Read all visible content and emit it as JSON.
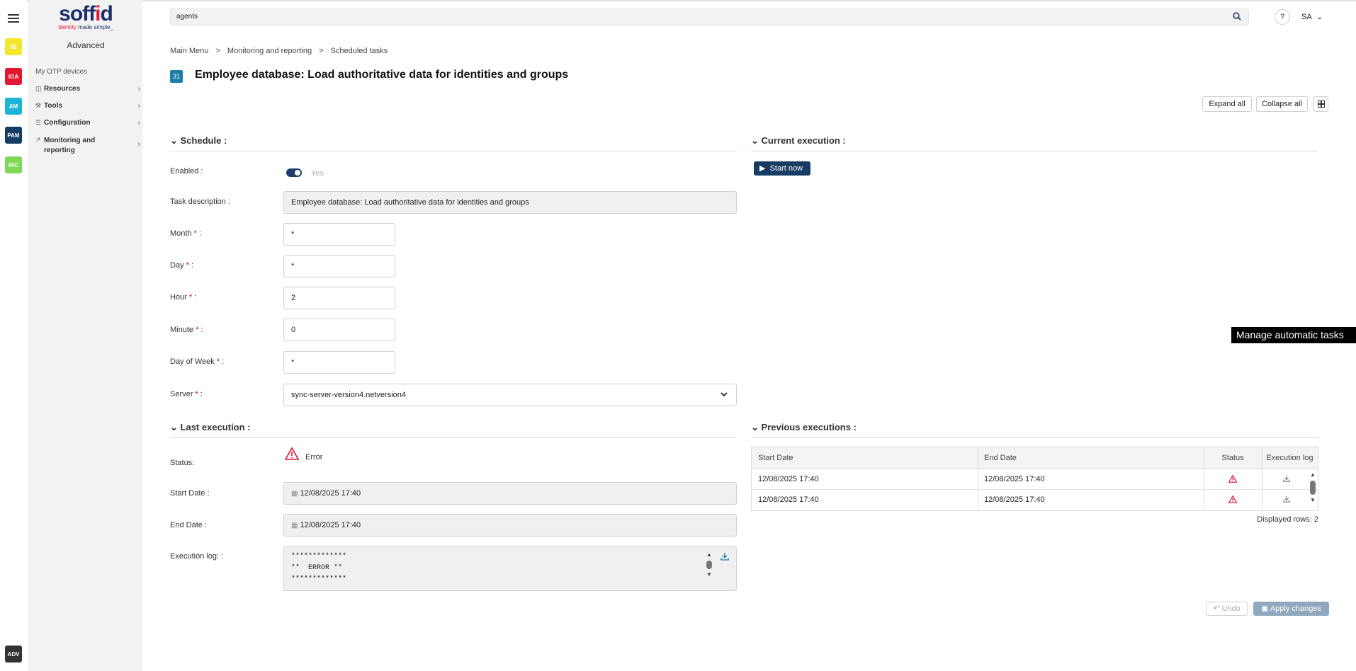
{
  "rail": {
    "apps": [
      {
        "label": "IIS",
        "color": "#f5e52c"
      },
      {
        "label": "IGA",
        "color": "#e3172f"
      },
      {
        "label": "AM",
        "color": "#1cb4d4"
      },
      {
        "label": "PAM",
        "color": "#173c64"
      },
      {
        "label": "IRC",
        "color": "#7ed957"
      }
    ],
    "bottom_app": {
      "label": "ADV",
      "color": "#333333"
    }
  },
  "sidebar": {
    "logo_text_a": "soff",
    "logo_text_i": "i",
    "logo_text_b": "d",
    "logo_tagline_a": "Identity",
    "logo_tagline_b": " made simple_",
    "mode_label": "Advanced",
    "items": [
      {
        "label": "My OTP devices"
      },
      {
        "label": "Resources"
      },
      {
        "label": "Tools"
      },
      {
        "label": "Configuration"
      },
      {
        "label": "Monitoring and reporting"
      }
    ]
  },
  "header": {
    "search_value": "agents",
    "help": "?",
    "user": "SA"
  },
  "breadcrumb": [
    "Main Menu",
    "Monitoring and reporting",
    "Scheduled tasks"
  ],
  "breadcrumb_sep": ">",
  "title": "Employee database: Load authoritative data for identities and groups",
  "toolbar": {
    "expand_all": "Expand all",
    "collapse_all": "Collapse all"
  },
  "schedule": {
    "title": "Schedule :",
    "enabled_label": "Enabled :",
    "enabled_value": "Yes",
    "task_description_label": "Task description :",
    "task_description_value": "Employee database: Load authoritative data for identities and groups",
    "month_label": "Month",
    "month_value": "*",
    "day_label": "Day",
    "day_value": "*",
    "hour_label": "Hour",
    "hour_value": "2",
    "minute_label": "Minute",
    "minute_value": "0",
    "dow_label": "Day of Week",
    "dow_value": "*",
    "server_label": "Server",
    "server_value": "sync-server-version4.netversion4",
    "required_mark": "*",
    "colon": " :"
  },
  "current_execution": {
    "title": "Current execution :",
    "start_now": "Start now"
  },
  "last_execution": {
    "title": "Last execution :",
    "status_label": "Status:",
    "status_value": "Error",
    "start_label": "Start Date :",
    "start_value": "12/08/2025 17:40",
    "end_label": "End Date :",
    "end_value": "12/08/2025 17:40",
    "log_label": "Execution log: :",
    "log_value": "*************\n**  ERROR **\n*************"
  },
  "previous_executions": {
    "title": "Previous executions :",
    "columns": [
      "Start Date",
      "End Date",
      "Status",
      "Execution log"
    ],
    "rows": [
      {
        "start": "12/08/2025 17:40",
        "end": "12/08/2025 17:40"
      },
      {
        "start": "12/08/2025 17:40",
        "end": "12/08/2025 17:40"
      }
    ],
    "displayed_rows": "Displayed rows: 2"
  },
  "tooltip": "Manage automatic tasks",
  "footer": {
    "undo": "Undo",
    "apply": "Apply changes"
  },
  "colors": {
    "navy": "#173c64",
    "error": "#e3172f",
    "accent_blue": "#1c7fa6"
  }
}
